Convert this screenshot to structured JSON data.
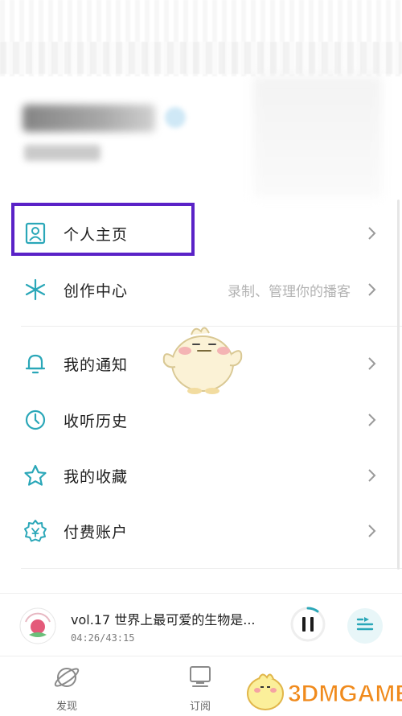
{
  "menu": {
    "items": [
      {
        "label": "个人主页",
        "hint": "",
        "icon": "profile-card-icon"
      },
      {
        "label": "创作中心",
        "hint": "录制、管理你的播客",
        "icon": "sparkle-icon"
      },
      {
        "label": "我的通知",
        "hint": "",
        "icon": "bell-icon"
      },
      {
        "label": "收听历史",
        "hint": "",
        "icon": "clock-icon"
      },
      {
        "label": "我的收藏",
        "hint": "",
        "icon": "star-icon"
      },
      {
        "label": "付费账户",
        "hint": "",
        "icon": "badge-icon"
      }
    ]
  },
  "player": {
    "title": "vol.17 世界上最可爱的生物是...",
    "time": "04:26/43:15",
    "progress": 0.102
  },
  "tabs": [
    {
      "label": "发现",
      "icon": "planet-icon"
    },
    {
      "label": "订阅",
      "icon": "monitor-icon"
    }
  ],
  "watermark": {
    "text": "3DMGAME"
  },
  "colors": {
    "accent": "#2aa7b8",
    "highlight": "#5a22c7",
    "watermark_orange": "#f08a1c"
  }
}
